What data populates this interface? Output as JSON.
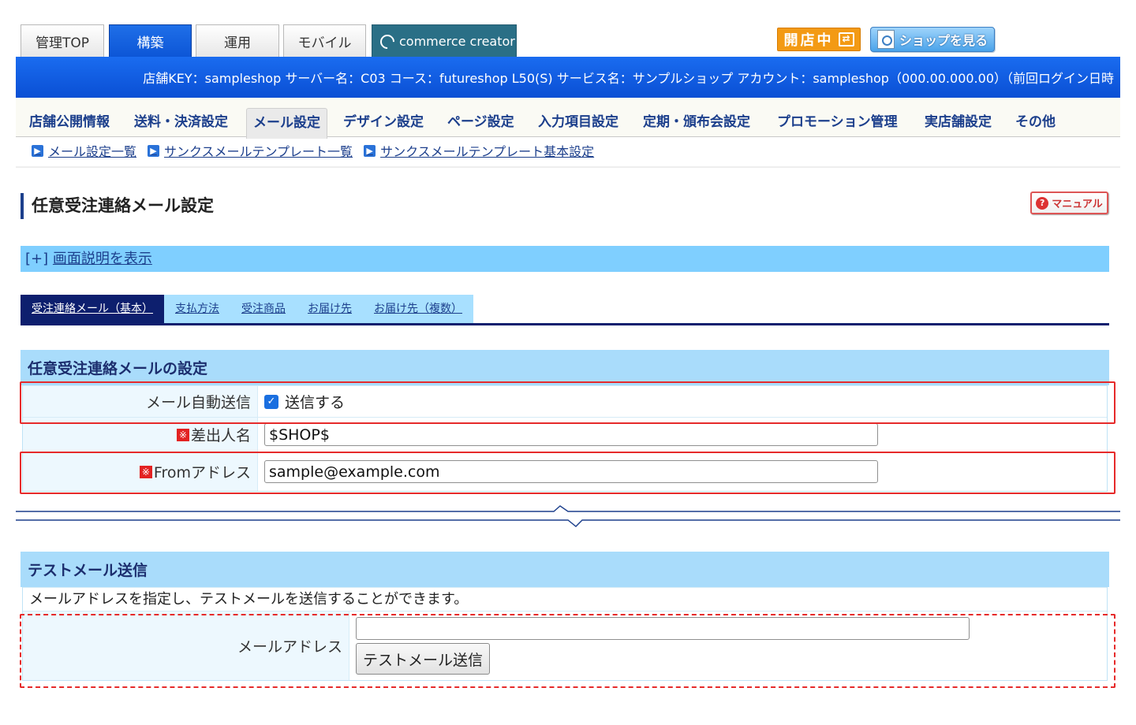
{
  "top_tabs": [
    "管理TOP",
    "構築",
    "運用",
    "モバイル"
  ],
  "cc_tab": "commerce creator",
  "status_badge": "開店中",
  "shop_button": "ショップを見る",
  "info_bar": "店舗KEY：sampleshop  サーバー名：C03  コース：futureshop L50(S)  サービス名：サンプルショップ  アカウント：sampleshop（000.00.000.00）（前回ログイン日時",
  "main_nav": [
    "店舗公開情報",
    "送料・決済設定",
    "メール設定",
    "デザイン設定",
    "ページ設定",
    "入力項目設定",
    "定期・頒布会設定",
    "プロモーション管理",
    "実店舗設定",
    "その他"
  ],
  "breadcrumb": [
    "メール設定一覧",
    "サンクスメールテンプレート一覧",
    "サンクスメールテンプレート基本設定"
  ],
  "page_title": "任意受注連絡メール設定",
  "manual_label": "マニュアル",
  "desc": {
    "prefix": "[+]",
    "link": "画面説明を表示"
  },
  "sub_tabs": [
    "受注連絡メール（基本）",
    "支払方法",
    "受注商品",
    "お届け先",
    "お届け先（複数）"
  ],
  "settings": {
    "title": "任意受注連絡メールの設定",
    "auto_send_label": "メール自動送信",
    "auto_send_checked": true,
    "auto_send_option": "送信する",
    "sender_label": "差出人名",
    "sender_value": "$SHOP$",
    "from_label": "Fromアドレス",
    "from_value": "sample@example.com",
    "required_mark": "※"
  },
  "test_mail": {
    "title": "テストメール送信",
    "note": "メールアドレスを指定し、テストメールを送信することができます。",
    "address_label": "メールアドレス",
    "address_value": "",
    "send_button": "テストメール送信"
  }
}
